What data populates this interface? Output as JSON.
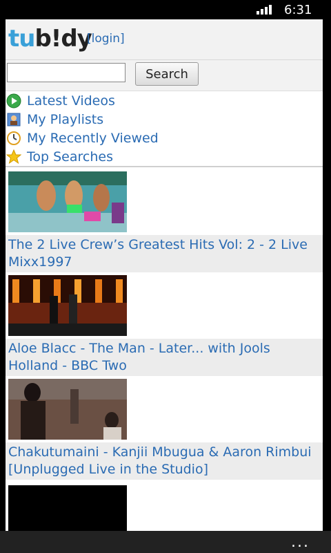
{
  "status_bar": {
    "time": "6:31",
    "signal_icon": "signal-icon"
  },
  "header": {
    "logo_tu": "tu",
    "logo_bidy": "b!dy",
    "login": "[login]"
  },
  "search": {
    "placeholder": "",
    "value": "",
    "button_label": "Search"
  },
  "nav": [
    {
      "label": "Latest Videos",
      "icon": "play-icon"
    },
    {
      "label": "My Playlists",
      "icon": "playlist-icon"
    },
    {
      "label": "My Recently Viewed",
      "icon": "clock-icon"
    },
    {
      "label": "Top Searches",
      "icon": "star-icon"
    }
  ],
  "videos": [
    {
      "title": "The 2 Live Crew’s Greatest Hits Vol: 2 - 2 Live Mixx1997"
    },
    {
      "title": "Aloe Blacc - The Man - Later... with Jools Holland - BBC Two"
    },
    {
      "title": "Chakutumaini - Kanjii Mbugua & Aaron Rimbui [Unplugged Live in the Studio]"
    }
  ],
  "app_bar": {
    "more": "..."
  }
}
